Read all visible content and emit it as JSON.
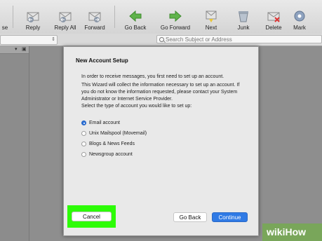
{
  "toolbar": {
    "partial_left_label": "se",
    "buttons": [
      {
        "label": "Reply",
        "icon": "reply-icon"
      },
      {
        "label": "Reply All",
        "icon": "reply-all-icon"
      },
      {
        "label": "Forward",
        "icon": "forward-icon"
      },
      {
        "label": "Go Back",
        "icon": "arrow-left-icon"
      },
      {
        "label": "Go Forward",
        "icon": "arrow-right-icon"
      },
      {
        "label": "Next",
        "icon": "next-icon"
      },
      {
        "label": "Junk",
        "icon": "junk-icon"
      },
      {
        "label": "Delete",
        "icon": "delete-icon"
      },
      {
        "label": "Mark",
        "icon": "mark-icon"
      }
    ]
  },
  "search": {
    "placeholder": "Search Subject or Address"
  },
  "dialog": {
    "title": "New Account Setup",
    "line1": "In order to receive messages, you first need to set up an account.",
    "line2": "This Wizard will collect the information necessary to set up an account. If you do not know the information requested, please contact your System Administrator or Internet Service Provider.",
    "line3": "Select the type of account you would like to set up:",
    "options": [
      {
        "label": "Email account",
        "selected": true
      },
      {
        "label": "Unix Mailspool (Movemail)",
        "selected": false
      },
      {
        "label": "Blogs & News Feeds",
        "selected": false
      },
      {
        "label": "Newsgroup account",
        "selected": false
      }
    ],
    "cancel": "Cancel",
    "back": "Go Back",
    "continue": "Continue"
  },
  "colors": {
    "highlight": "#2dfc07",
    "accent": "#2f7ae5"
  },
  "watermark": {
    "prefix": "wiki",
    "suffix": "How"
  }
}
